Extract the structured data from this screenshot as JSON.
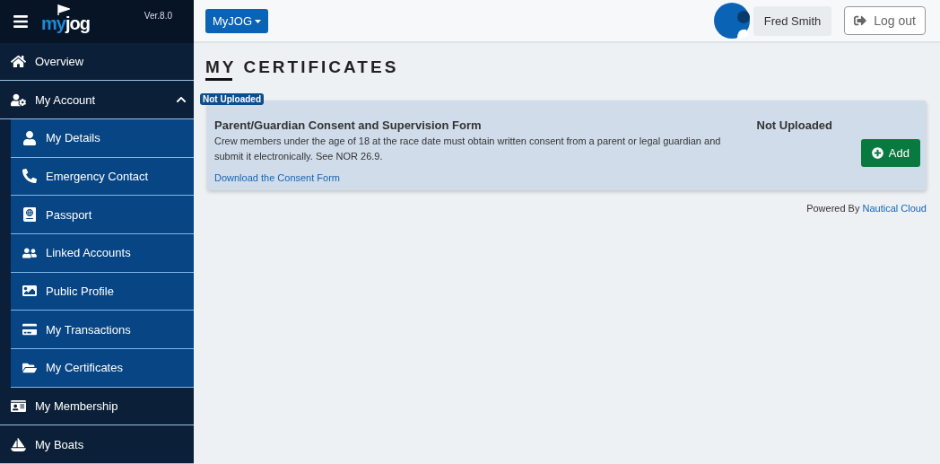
{
  "sidebar": {
    "version": "Ver.8.0",
    "logo": {
      "part_1": "my",
      "part_2": "jog"
    },
    "items": [
      {
        "label": "Overview"
      },
      {
        "label": "My Account",
        "expanded": true,
        "children": [
          {
            "label": "My Details"
          },
          {
            "label": "Emergency Contact"
          },
          {
            "label": "Passport"
          },
          {
            "label": "Linked Accounts"
          },
          {
            "label": "Public Profile"
          },
          {
            "label": "My Transactions"
          },
          {
            "label": "My Certificates"
          }
        ]
      },
      {
        "label": "My Membership"
      },
      {
        "label": "My Boats"
      }
    ]
  },
  "header": {
    "menu_button": "MyJOG",
    "user_name": "Fred Smith",
    "logout": "Log out"
  },
  "page": {
    "title": "MY CERTIFICATES",
    "certificates": [
      {
        "badge": "Not Uploaded",
        "name": "Parent/Guardian Consent and Supervision Form",
        "description": "Crew members under the age of 18 at the race date must obtain written consent from a parent or legal guardian and submit it electronically. See NOR 26.9.",
        "link": "Download the Consent Form",
        "status": "Not Uploaded",
        "action": "Add"
      }
    ],
    "footer": {
      "prefix": "Powered By",
      "link": "Nautical Cloud"
    }
  }
}
